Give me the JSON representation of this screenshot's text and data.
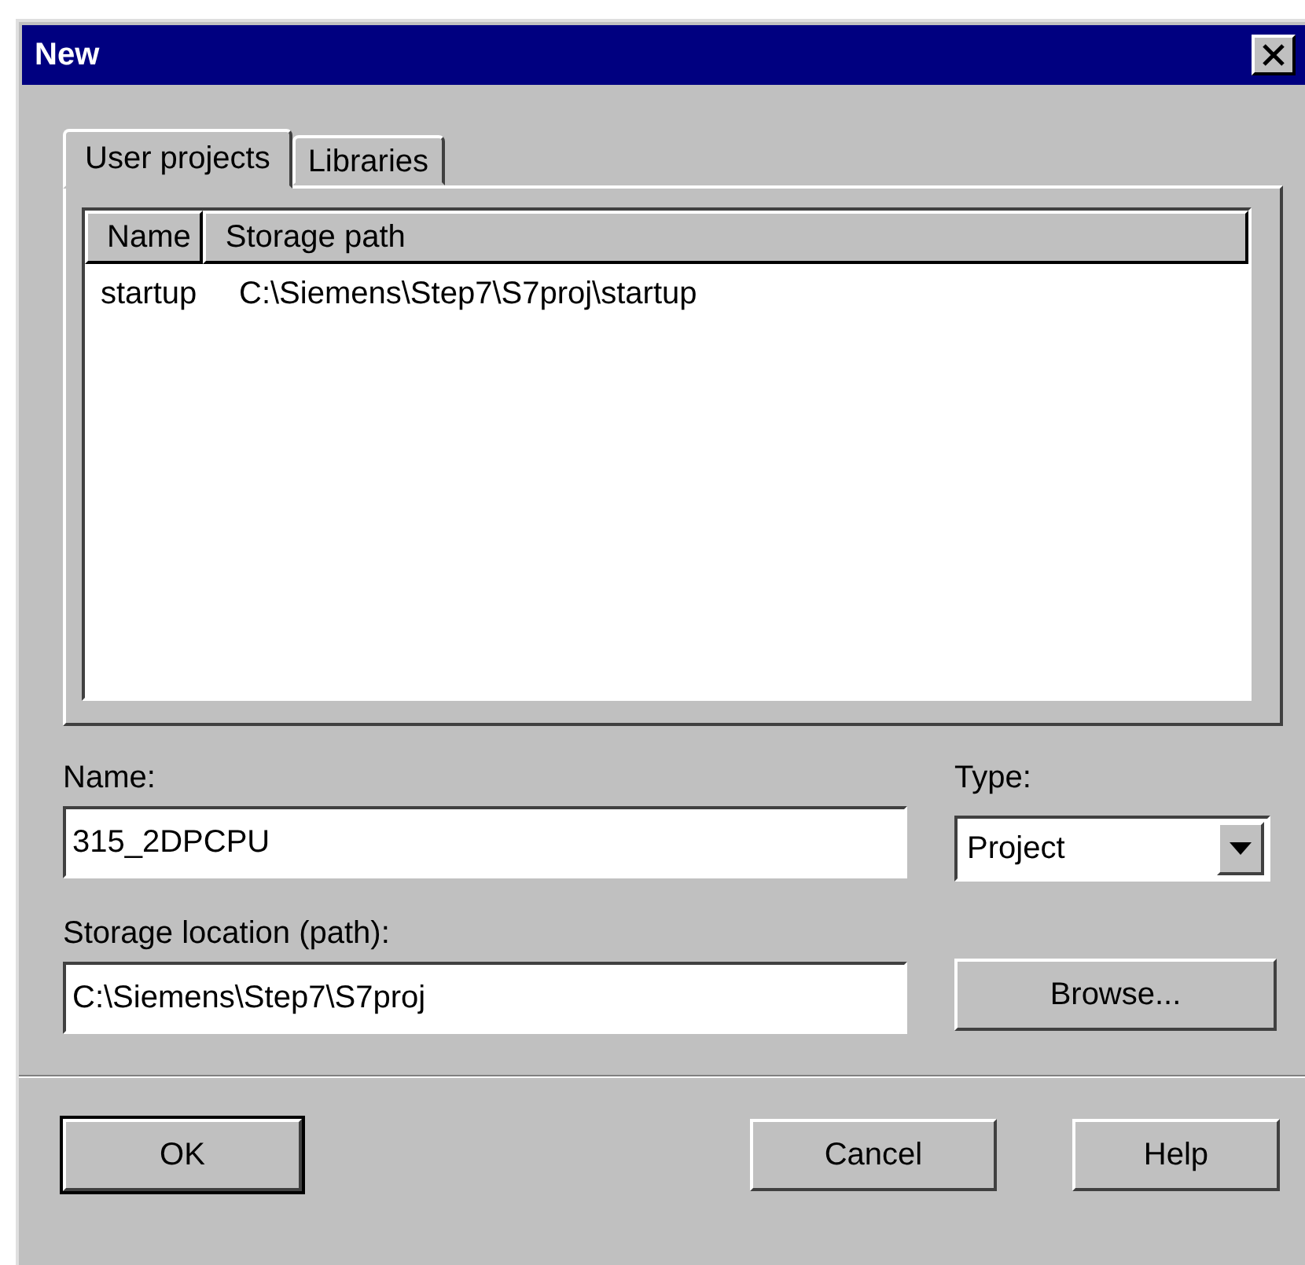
{
  "window": {
    "title": "New"
  },
  "tabs": [
    {
      "label": "User projects",
      "selected": true
    },
    {
      "label": "Libraries",
      "selected": false
    }
  ],
  "table": {
    "columns": [
      "Name",
      "Storage path"
    ],
    "rows": [
      [
        "startup",
        "C:\\Siemens\\Step7\\S7proj\\startup"
      ]
    ]
  },
  "name_field": {
    "label": "Name:",
    "value": "315_2DPCPU"
  },
  "type_field": {
    "label": "Type:",
    "value": "Project"
  },
  "location_field": {
    "label": "Storage location (path):",
    "value": "C:\\Siemens\\Step7\\S7proj"
  },
  "browse_button": "Browse...",
  "buttons": [
    {
      "label": "OK",
      "kind": "default"
    },
    {
      "label": "Cancel",
      "kind": "normal"
    },
    {
      "label": "Help",
      "kind": "normal"
    }
  ]
}
